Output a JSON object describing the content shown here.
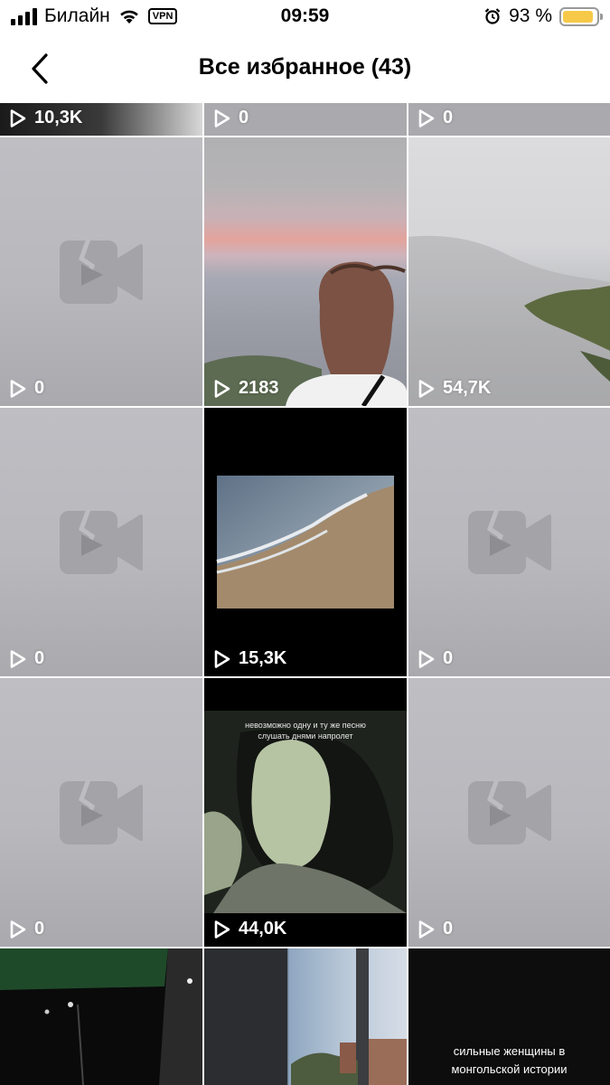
{
  "status_bar": {
    "carrier": "Билайн",
    "vpn": "VPN",
    "time": "09:59",
    "battery_percent": "93 %",
    "battery_level": 0.93,
    "battery_color": "#F7C948"
  },
  "header": {
    "title": "Все избранное (43)",
    "back_icon": "chevron-left-icon"
  },
  "colors": {
    "placeholder_bg": "#BEBEC3",
    "placeholder_icon": "#A3A3A8",
    "play_count_text": "#FFFFFF"
  },
  "grid": {
    "items": [
      {
        "views": "10,3K",
        "type": "video"
      },
      {
        "views": "0",
        "type": "placeholder"
      },
      {
        "views": "0",
        "type": "placeholder"
      },
      {
        "views": "0",
        "type": "placeholder"
      },
      {
        "views": "2183",
        "type": "video"
      },
      {
        "views": "54,7K",
        "type": "video"
      },
      {
        "views": "0",
        "type": "placeholder"
      },
      {
        "views": "15,3K",
        "type": "video"
      },
      {
        "views": "0",
        "type": "placeholder"
      },
      {
        "views": "0",
        "type": "placeholder"
      },
      {
        "views": "44,0K",
        "type": "video",
        "caption": "невозможно одну и ту же песню слушать днями напролет"
      },
      {
        "views": "0",
        "type": "placeholder"
      },
      {
        "views": "",
        "type": "video"
      },
      {
        "views": "",
        "type": "video"
      },
      {
        "views": "",
        "type": "video",
        "caption": "сильные женщины в монгольской истории"
      }
    ]
  }
}
